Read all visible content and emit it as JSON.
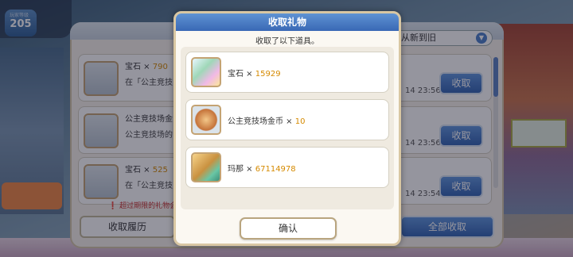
{
  "hud": {
    "level_caption": "玩家等级",
    "level_value": "205"
  },
  "gift_list": {
    "sort_label": "从新到旧",
    "rows": [
      {
        "name": "宝石",
        "qty": "790",
        "desc": "在「公主竞技",
        "time": "14  23:56",
        "claim_label": "收取"
      },
      {
        "name": "公主竞技场金",
        "qty": "",
        "desc": "公主竞技场的",
        "time": "14  23:56",
        "claim_label": "收取"
      },
      {
        "name": "宝石",
        "qty": "525",
        "desc": "在「公主竞技",
        "time": "14  23:54",
        "claim_label": "收取"
      }
    ],
    "expire_note": "超过期限的礼物会",
    "history_label": "收取履历",
    "claim_all_label": "全部收取"
  },
  "modal": {
    "title": "收取礼物",
    "subtitle": "收取了以下道具。",
    "items": [
      {
        "name": "宝石",
        "times": " × ",
        "qty": "15929",
        "icon": "gem-icon"
      },
      {
        "name": "公主竞技场金币",
        "times": " × ",
        "qty": "10",
        "icon": "arena-coin-icon"
      },
      {
        "name": "玛那",
        "times": " × ",
        "qty": "67114978",
        "icon": "mana-icon"
      }
    ],
    "confirm_label": "确认"
  },
  "colors": {
    "accent_blue": "#3968b5",
    "qty_orange": "#d58a00",
    "gold_border": "#d9c7a3"
  }
}
